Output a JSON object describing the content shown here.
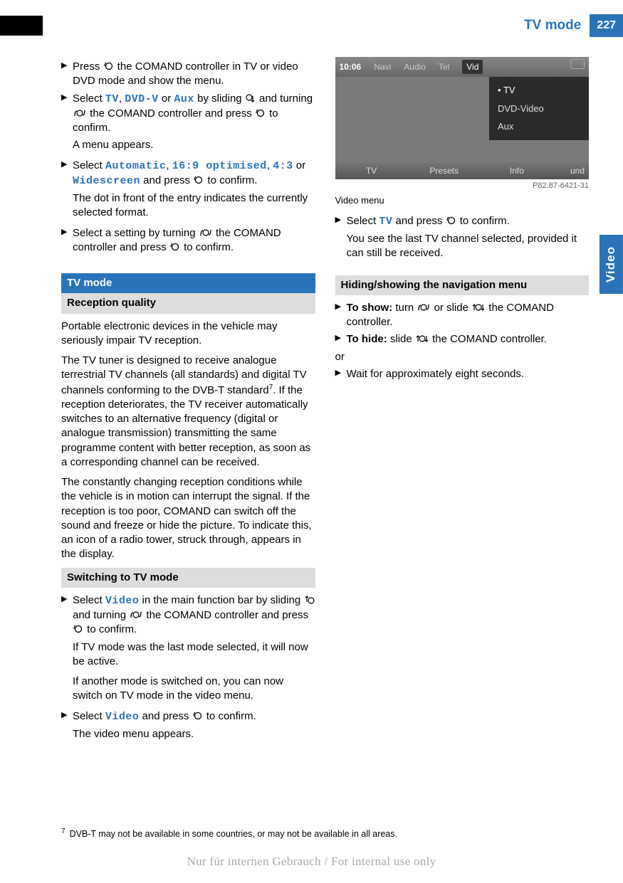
{
  "page": {
    "header_title": "TV mode",
    "number": "227",
    "side_tab": "Video",
    "watermark": "Nur für internen Gebrauch / For internal use only"
  },
  "left": {
    "step1a": "Press ",
    "step1b": " the COMAND controller in TV or video DVD mode and show the menu.",
    "step2a": "Select ",
    "tv": "TV",
    "sep": ", ",
    "dvdv": "DVD-V",
    "or": " or ",
    "aux": "Aux",
    "step2b": " by sliding ",
    "step2c": " and turning ",
    "step2d": " the COMAND controller and press ",
    "step2e": " to confirm.",
    "step2f": "A menu appears.",
    "step3a": "Select ",
    "auto": "Automatic",
    "opt": "16:9 optimised",
    "ratio": "4:3",
    "wide": "Widescreen",
    "step3b": " and press ",
    "step3c": " to confirm.",
    "step3d": "The dot in front of the entry indicates the currently selected format.",
    "step4a": "Select a setting by turning ",
    "step4b": " the COMAND controller and press ",
    "step4c": " to confirm.",
    "h_blue": "TV mode",
    "h_grey": "Reception quality",
    "p1": "Portable electronic devices in the vehicle may seriously impair TV reception.",
    "p2a": "The TV tuner is designed to receive analogue terrestrial TV channels (all standards) and digital TV channels conforming to the DVB-T standard",
    "p2b": ". If the reception deteriorates, the TV receiver automatically switches to an alternative frequency (digital or analogue transmission) transmitting the same programme content with better reception, as soon as a corresponding channel can be received.",
    "p3": "The constantly changing reception conditions while the vehicle is in motion can interrupt the signal. If the reception is too poor, COMAND can switch off the sound and freeze or hide the picture. To indicate this, an icon of a radio tower, struck through, appears in the display."
  },
  "right": {
    "h1": "Switching to TV mode",
    "s1a": "Select ",
    "video": "Video",
    "s1b": " in the main function bar by sliding ",
    "s1c": " and turning ",
    "s1d": " the COMAND controller and press ",
    "s1e": " to confirm.",
    "s1f": "If TV mode was the last mode selected, it will now be active.",
    "s1g": "If another mode is switched on, you can now switch on TV mode in the video menu.",
    "s2a": "Select ",
    "s2b": " and press ",
    "s2c": " to confirm.",
    "s2d": "The video menu appears.",
    "img_ref": "P82.87-6421-31",
    "caption": "Video menu",
    "s3a": "Select ",
    "s3b": " and press ",
    "s3c": " to confirm.",
    "s3d": "You see the last TV channel selected, provided it can still be received.",
    "h2": "Hiding/showing the navigation menu",
    "s4a": "To show:",
    "s4b": " turn ",
    "s4c": " or slide ",
    "s4d": " the COMAND controller.",
    "s5a": "To hide:",
    "s5b": " slide ",
    "s5c": " the COMAND controller.",
    "or": "or",
    "s6": "Wait for approximately eight seconds."
  },
  "screenshot": {
    "time": "10:06",
    "tabs": [
      "Navi",
      "Audio",
      "Tel",
      "Vid"
    ],
    "menu": [
      "TV",
      "DVD-Video",
      "Aux"
    ],
    "bottom": [
      "TV",
      "Presets",
      "Info",
      "und"
    ]
  },
  "footnote": {
    "num": "7",
    "text": "DVB-T may not be available in some countries, or may not be available in all areas."
  }
}
